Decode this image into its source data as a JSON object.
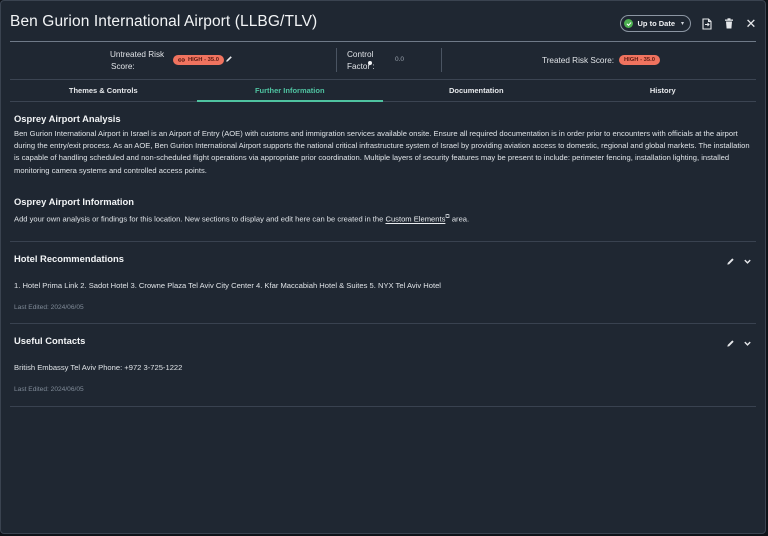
{
  "window": {
    "title": "Ben Gurion International Airport (LLBG/TLV)",
    "status_label": "Up to Date"
  },
  "risk": {
    "untreated_label_line1": "Untreated Risk",
    "untreated_label_line2": "Score:",
    "untreated_badge": "HIGH - 35.0",
    "control_label_line1": "Control",
    "control_label_line2": "Factor",
    "control_value": "0.0",
    "treated_label": "Treated Risk Score:",
    "treated_badge": "HIGH - 35.0",
    "badge_color": "#f0735f"
  },
  "tabs": [
    {
      "label": "Themes & Controls",
      "active": false
    },
    {
      "label": "Further Information",
      "active": true
    },
    {
      "label": "Documentation",
      "active": false
    },
    {
      "label": "History",
      "active": false
    }
  ],
  "analysis": {
    "heading": "Osprey Airport Analysis",
    "body": "Ben Gurion International Airport in Israel is an Airport of Entry (AOE) with customs and immigration services available onsite. Ensure all required documentation is in order prior to encounters with officials at the airport during the entry/exit process. As an AOE, Ben Gurion International Airport supports the national critical infrastructure system of Israel by providing aviation access to domestic, regional and global markets. The installation is capable of handling scheduled and non-scheduled flight operations via appropriate prior coordination. Multiple layers of security features may be present to include: perimeter fencing, installation lighting, installed monitoring camera systems and controlled access points."
  },
  "information": {
    "heading": "Osprey Airport Information",
    "body_before_link": "Add your own analysis or findings for this location. New sections to display and edit here can be created in the ",
    "link_text": "Custom Elements",
    "body_after_link": " area."
  },
  "sections": [
    {
      "title": "Hotel Recommendations",
      "body": "1. Hotel Prima Link 2. Sadot Hotel 3. Crowne Plaza Tel Aviv City Center 4. Kfar Maccabiah Hotel & Suites 5. NYX Tel Aviv Hotel",
      "meta": "Last Edited: 2024/06/05"
    },
    {
      "title": "Useful Contacts",
      "body": "British Embassy Tel Aviv Phone: +972 3-725-1222",
      "meta": "Last Edited: 2024/06/05"
    }
  ],
  "colors": {
    "accent": "#4fc3a1",
    "status_ok": "#4caf50",
    "panel": "#1f2732"
  },
  "icons": {
    "status": "check-circle-icon",
    "export": "document-export-icon",
    "delete": "trash-icon",
    "close": "close-icon",
    "edit": "pencil-icon",
    "expand": "chevron-down-icon",
    "link": "link-icon",
    "external": "external-link-icon",
    "info": "info-dot-icon"
  }
}
